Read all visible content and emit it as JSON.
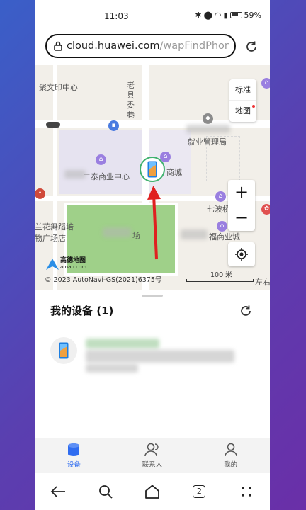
{
  "status_bar": {
    "time": "11:03",
    "battery": "59%",
    "icons": [
      "bluetooth-icon",
      "location-icon",
      "wifi-icon",
      "signal-icon",
      "battery-icon"
    ]
  },
  "browser": {
    "url_domain": "cloud.huawei.com",
    "url_path": "/wapFindPhone..."
  },
  "map": {
    "labels": {
      "wenyinzhongxin": "聚文印中心",
      "laoxian": "老\n县\n委\n巷",
      "jiuye": "就业管理局",
      "shangye": "二泰商业中心",
      "shangcheng": "商城",
      "qibo": "七波桥",
      "fuxing": "福商业城",
      "wudao1": "兰花舞蹈培",
      "wudao2": "物广场店",
      "chang": "场",
      "zuoyou": "左右"
    },
    "map_type": {
      "standard": "标准",
      "map": "地图"
    },
    "zoom_in": "+",
    "zoom_out": "−",
    "copyright": "© 2023 AutoNavi-GS(2021)6375号",
    "amap_name": "高德地图",
    "amap_url": "amap.com",
    "scale": "100 米"
  },
  "sheet": {
    "title": "我的设备 (1)"
  },
  "tabs": [
    {
      "label": "设备",
      "icon": "device-icon",
      "active": true
    },
    {
      "label": "联系人",
      "icon": "contacts-icon",
      "active": false
    },
    {
      "label": "我的",
      "icon": "profile-icon",
      "active": false
    }
  ],
  "nav": {
    "tab_count": "2"
  },
  "colors": {
    "accent": "#2f6cf0",
    "marker_ring": "#3fb16e",
    "arrow": "#e02020",
    "poi": "#9a7fe0"
  }
}
